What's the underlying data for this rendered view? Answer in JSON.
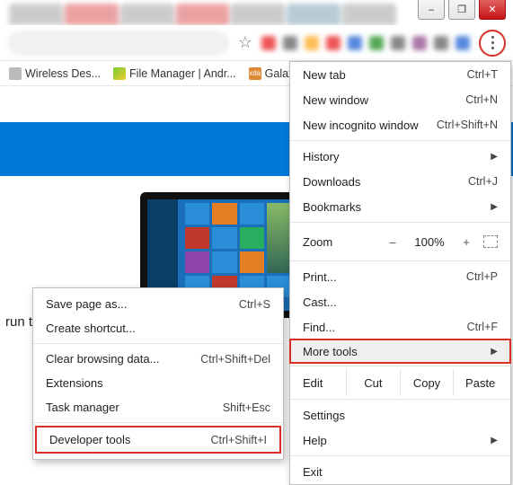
{
  "window": {
    "minimize": "–",
    "maximize": "❐",
    "close": "✕"
  },
  "toolbar": {
    "star_glyph": "☆"
  },
  "bookmarks": {
    "items": [
      {
        "label": "Wireless Des..."
      },
      {
        "label": "File Manager | Andr..."
      },
      {
        "label": "Galaxy",
        "prefix": "xda"
      }
    ]
  },
  "page": {
    "run_text": "run the"
  },
  "menu": {
    "new_tab": {
      "label": "New tab",
      "shortcut": "Ctrl+T"
    },
    "new_window": {
      "label": "New window",
      "shortcut": "Ctrl+N"
    },
    "new_incognito": {
      "label": "New incognito window",
      "shortcut": "Ctrl+Shift+N"
    },
    "history": {
      "label": "History"
    },
    "downloads": {
      "label": "Downloads",
      "shortcut": "Ctrl+J"
    },
    "bookmarks": {
      "label": "Bookmarks"
    },
    "zoom": {
      "label": "Zoom",
      "minus": "–",
      "pct": "100%",
      "plus": "+"
    },
    "print": {
      "label": "Print...",
      "shortcut": "Ctrl+P"
    },
    "cast": {
      "label": "Cast..."
    },
    "find": {
      "label": "Find...",
      "shortcut": "Ctrl+F"
    },
    "more_tools": {
      "label": "More tools"
    },
    "edit": {
      "label": "Edit",
      "cut": "Cut",
      "copy": "Copy",
      "paste": "Paste"
    },
    "settings": {
      "label": "Settings"
    },
    "help": {
      "label": "Help"
    },
    "exit": {
      "label": "Exit"
    }
  },
  "submenu": {
    "save_page": {
      "label": "Save page as...",
      "shortcut": "Ctrl+S"
    },
    "create_shortcut": {
      "label": "Create shortcut..."
    },
    "clear_data": {
      "label": "Clear browsing data...",
      "shortcut": "Ctrl+Shift+Del"
    },
    "extensions": {
      "label": "Extensions"
    },
    "task_manager": {
      "label": "Task manager",
      "shortcut": "Shift+Esc"
    },
    "dev_tools": {
      "label": "Developer tools",
      "shortcut": "Ctrl+Shift+I"
    }
  }
}
